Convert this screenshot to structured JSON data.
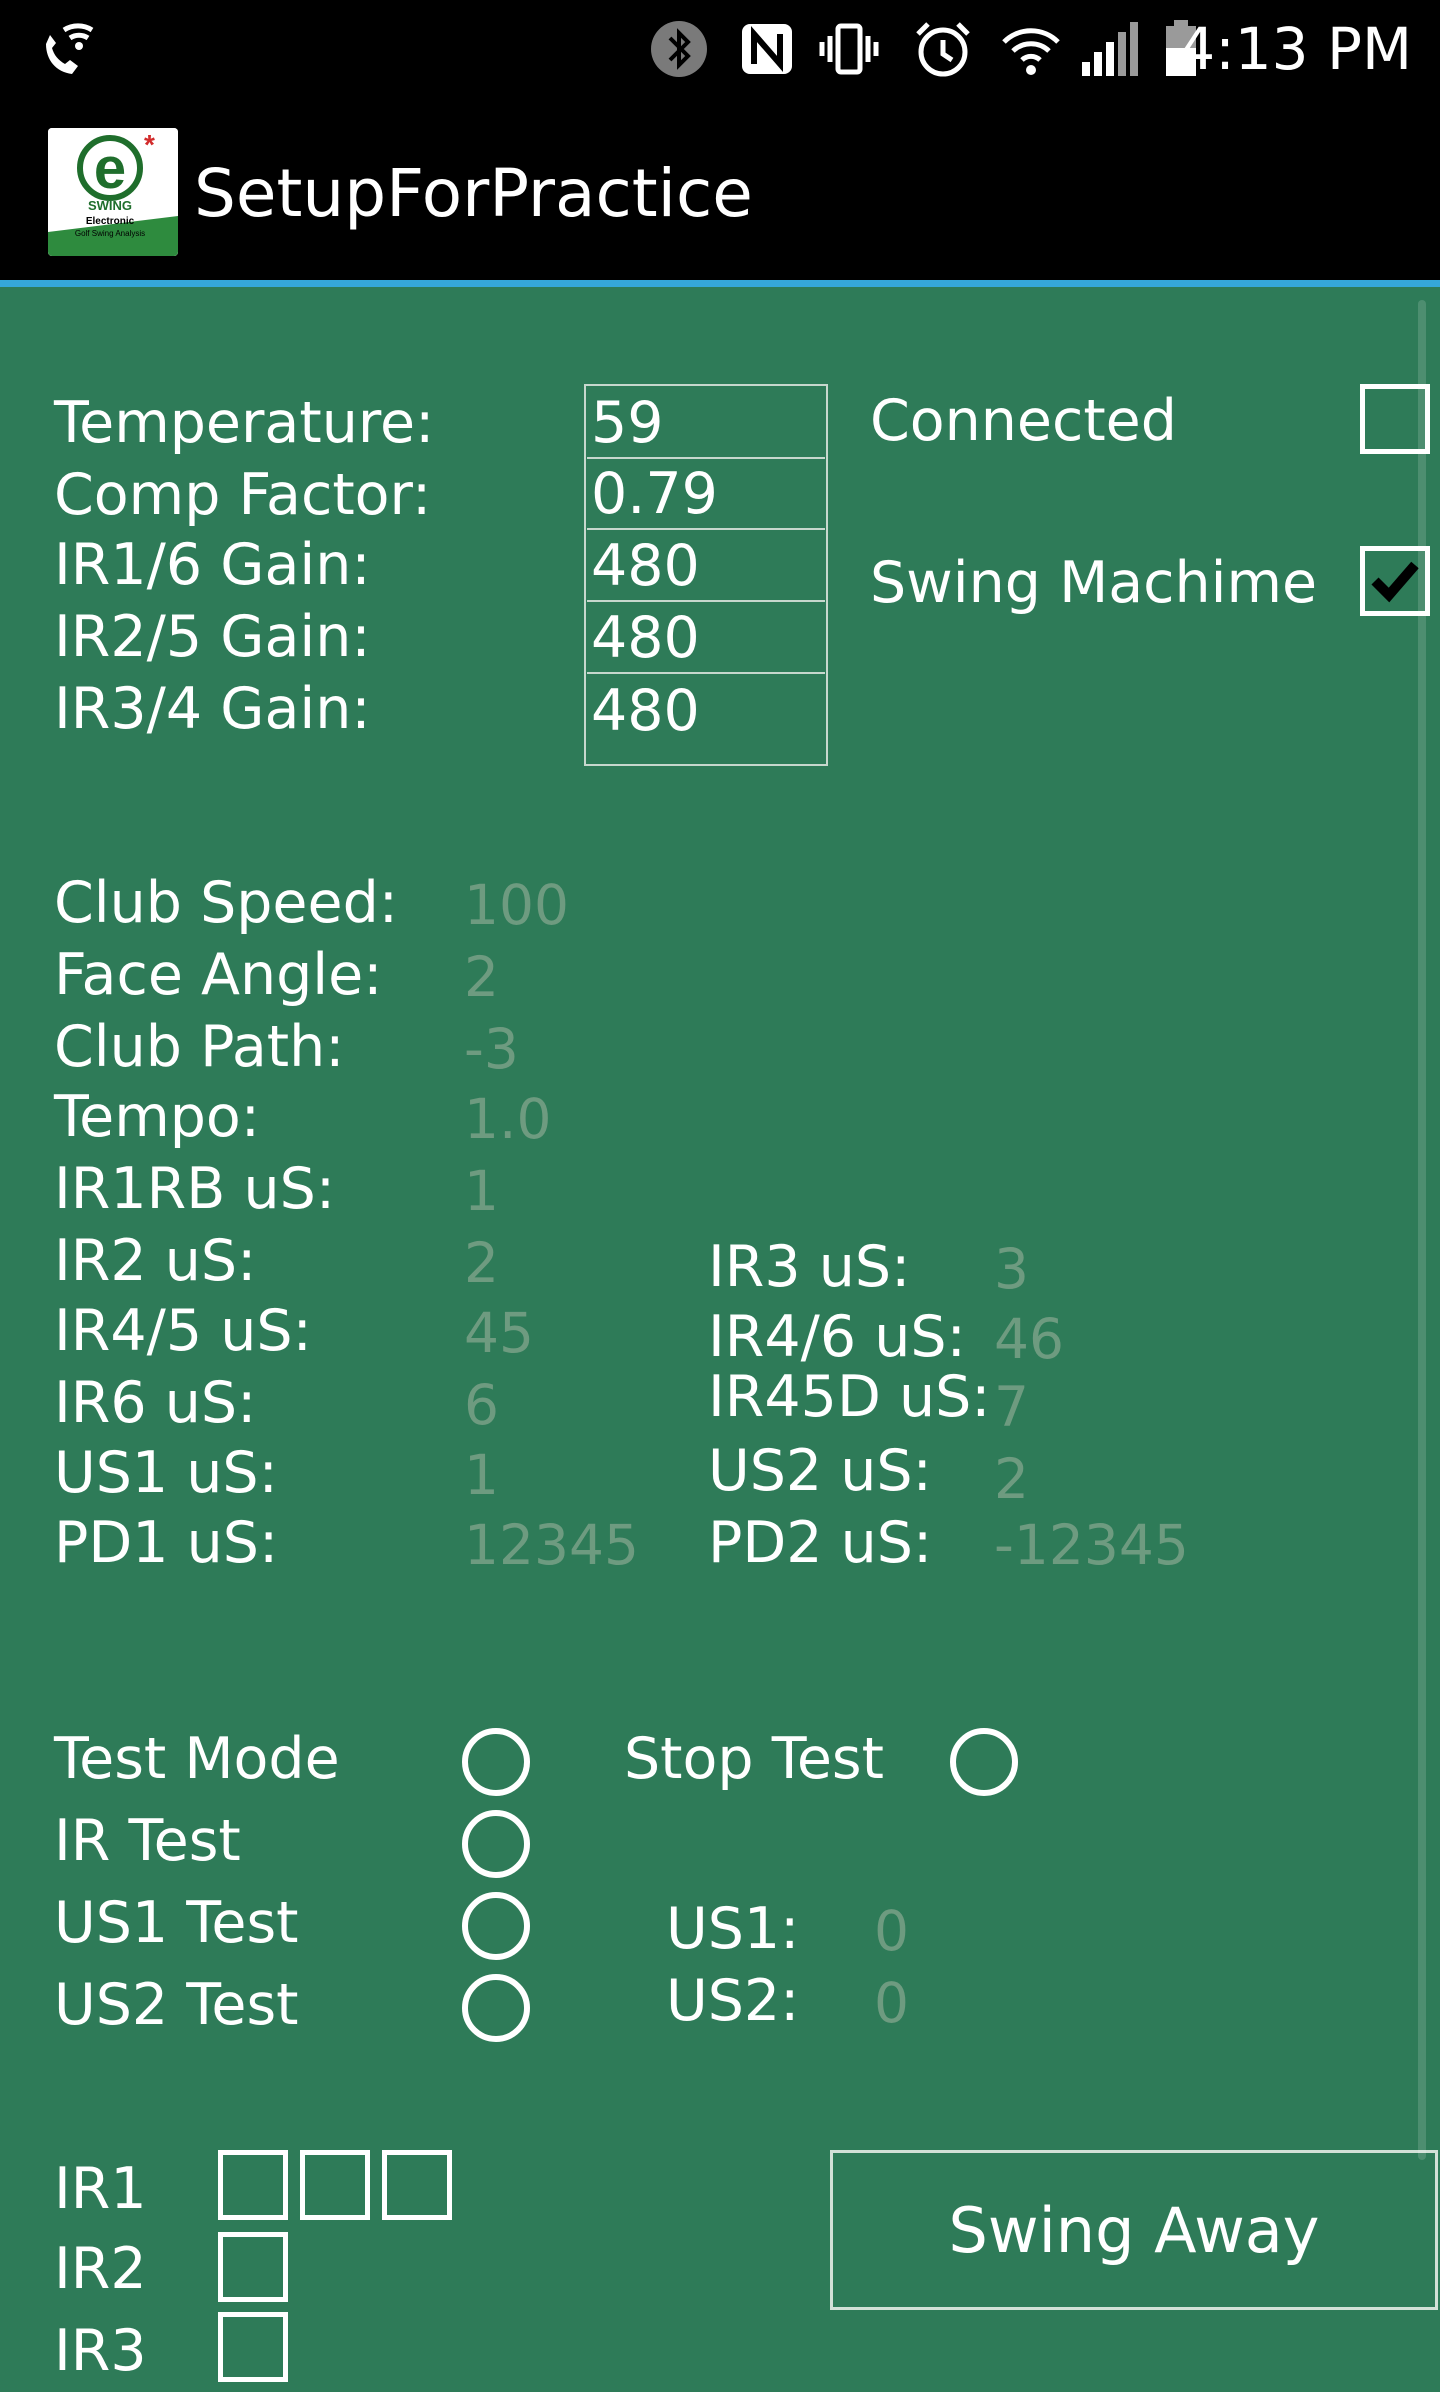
{
  "status_bar": {
    "time": "4:13 PM",
    "icons": [
      "phone-wifi-icon",
      "bluetooth-icon",
      "nfc-icon",
      "vibrate-icon",
      "alarm-icon",
      "wifi-icon",
      "signal-icon",
      "battery-icon"
    ]
  },
  "app_bar": {
    "title": "SetupForPractice",
    "logo_text_main": "e",
    "logo_text_swing": "SWING",
    "logo_text_tag1": "Electronic",
    "logo_text_tag2": "Golf Swing Analysis"
  },
  "settings": {
    "temperature_label": "Temperature:",
    "temperature_value": "59",
    "comp_label": "Comp Factor:",
    "comp_value": "0.79",
    "ir16_label": "IR1/6 Gain:",
    "ir16_value": "480",
    "ir25_label": "IR2/5 Gain:",
    "ir25_value": "480",
    "ir34_label": "IR3/4 Gain:",
    "ir34_value": "480"
  },
  "options": {
    "connected_label": "Connected",
    "connected_checked": false,
    "swing_label": "Swing Machime",
    "swing_checked": true
  },
  "metrics": {
    "club_speed_label": "Club Speed:",
    "club_speed_value": "100",
    "face_angle_label": "Face Angle:",
    "face_angle_value": "2",
    "club_path_label": "Club Path:",
    "club_path_value": "-3",
    "tempo_label": "Tempo:",
    "tempo_value": "1.0",
    "ir1rb_label": "IR1RB uS:",
    "ir1rb_value": "1",
    "ir2_label": "IR2 uS:",
    "ir2_value": "2",
    "ir45_label": "IR4/5 uS:",
    "ir45_value": "45",
    "ir6_label": "IR6 uS:",
    "ir6_value": "6",
    "us1_label": "US1 uS:",
    "us1_value": "1",
    "pd1_label": "PD1 uS:",
    "pd1_value": "12345",
    "ir3_label": "IR3 uS:",
    "ir3_value": "3",
    "ir46_label": "IR4/6 uS:",
    "ir46_value": "46",
    "ir45d_label": "IR45D uS:",
    "ir45d_value": "7",
    "us2_label": "US2 uS:",
    "us2_value": "2",
    "pd2_label": "PD2 uS:",
    "pd2_value": "-12345"
  },
  "tests": {
    "test_mode": "Test Mode",
    "stop_test": "Stop Test",
    "ir_test": "IR Test",
    "us1_test": "US1 Test",
    "us2_test": "US2 Test",
    "us1_label": "US1:",
    "us1_value": "0",
    "us2_label": "US2:",
    "us2_value": "0"
  },
  "ir_rows": {
    "ir1": "IR1",
    "ir2": "IR2",
    "ir3": "IR3"
  },
  "swing_button": "Swing Away"
}
